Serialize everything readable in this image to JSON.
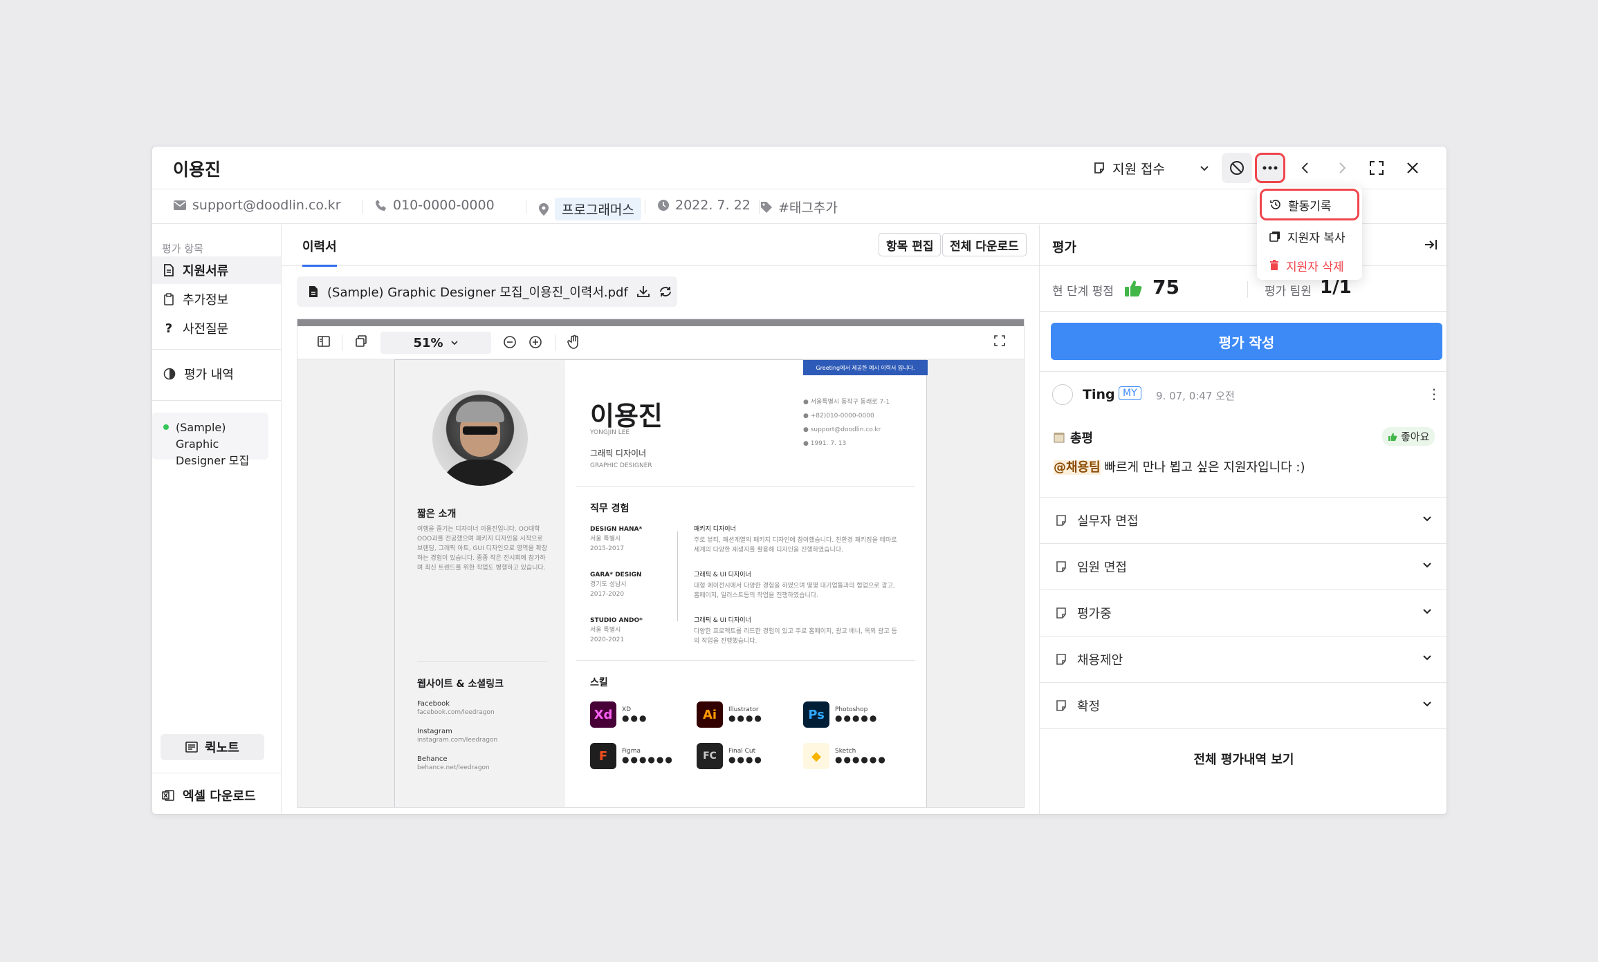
{
  "header": {
    "name": "이용진",
    "status": "지원 접수"
  },
  "info": {
    "email": "support@doodlin.co.kr",
    "phone": "010-0000-0000",
    "location": "프로그래머스",
    "date": "2022. 7. 22",
    "tag": "#태그추가"
  },
  "sidebar": {
    "caption": "평가 항목",
    "items": [
      "지원서류",
      "추가정보",
      "사전질문"
    ],
    "history": "평가 내역",
    "posting": "(Sample) Graphic Designer 모집",
    "quicknote": "퀵노트",
    "excel": "엑셀 다운로드"
  },
  "main": {
    "tab": "이력서",
    "edit_btn": "항목 편집",
    "download_btn": "전체 다운로드",
    "file": "(Sample) Graphic Designer 모집_이용진_이력서.pdf",
    "zoom": "51%"
  },
  "resume": {
    "banner": "Greeting에서 제공한 예시 이력서 입니다.",
    "name": "이용진",
    "name_en": "YONGJIN LEE",
    "role": "그래픽 디자이너",
    "role_en": "GRAPHIC DESIGNER",
    "contacts": [
      "서울특별시 동작구 동래로 7-1",
      "+82)010-0000-0000",
      "support@doodlin.co.kr",
      "1991. 7. 13"
    ],
    "intro_title": "짧은 소개",
    "intro": "여행을 즐기는 디자이너 이용진입니다. OO대학 OOO과를 전공했으며 패키지 디자인을 시작으로 브랜딩, 그래픽 아트, GUI 디자인으로 영역을 확장하는 경험이 있습니다. 종종 작은 전시회에 참가하며 최신 트렌드를 위한 작업도 병행하고 있습니다.",
    "links_title": "웹사이트 & 소셜링크",
    "links": [
      {
        "name": "Facebook",
        "url": "facebook.com/leedragon"
      },
      {
        "name": "Instagram",
        "url": "instagram.com/leedragon"
      },
      {
        "name": "Behance",
        "url": "behance.net/leedragon"
      }
    ],
    "exp_title": "직무 경험",
    "experience": [
      {
        "company": "DESIGN HANA*",
        "loc": "서울 특별시",
        "period": "2015-2017",
        "role": "패키지 디자이너",
        "desc": "주로 뷰티, 패션계열의 패키지 디자인에 참여했습니다. 친환경 패키징을 테마로 세계의 다양한 재생지를 활용해 디자인을 진행하였습니다."
      },
      {
        "company": "GARA* DESIGN",
        "loc": "경기도 성남시",
        "period": "2017-2020",
        "role": "그래픽 & UI 디자이너",
        "desc": "대형 에이전시에서 다양한 경험을 하였으며 몇몇 대기업들과의 협업으로 광고, 홈페이지, 일러스트등의 작업을 진행하였습니다."
      },
      {
        "company": "STUDIO ANDO*",
        "loc": "서울 특별시",
        "period": "2020-2021",
        "role": "그래픽 & UI 디자이너",
        "desc": "다양한 프로젝트를 리드한 경험이 있고 주로 홈페이지, 광고 배너, 옥외 광고 등의 작업을 진행했습니다."
      }
    ],
    "skills_title": "스킬",
    "skills": [
      {
        "name": "XD",
        "abbr": "Xd",
        "dots": "●●●",
        "bg": "#470137",
        "fg": "#ff61f6"
      },
      {
        "name": "Illustrator",
        "abbr": "Ai",
        "dots": "●●●●",
        "bg": "#330000",
        "fg": "#ff9a00"
      },
      {
        "name": "Photoshop",
        "abbr": "Ps",
        "dots": "●●●●●",
        "bg": "#001e36",
        "fg": "#31a8ff"
      },
      {
        "name": "Figma",
        "abbr": "F",
        "dots": "●●●●●●",
        "bg": "#1e1e1e",
        "fg": "#f24e1e"
      },
      {
        "name": "Final Cut",
        "abbr": "FC",
        "dots": "●●●●",
        "bg": "#222222",
        "fg": "#c9c9c9"
      },
      {
        "name": "Sketch",
        "abbr": "◆",
        "dots": "●●●●●●",
        "bg": "#fff7e0",
        "fg": "#f7b500"
      }
    ]
  },
  "evaluation": {
    "title": "평가",
    "stage_score_label": "현 단계 평점",
    "score": "75",
    "members_label": "평가 팀원",
    "members": "1/1",
    "write_btn": "평가 작성",
    "comment": {
      "author": "Ting",
      "badge": "MY",
      "time": "9. 07, 0:47 오전",
      "category": "총평",
      "reaction": "좋아요",
      "mention": "@채용팀",
      "text": " 빠르게 만나 뵙고 싶은 지원자입니다 :)"
    },
    "stages": [
      "실무자 면접",
      "임원 면접",
      "평가중",
      "채용제안",
      "확정"
    ],
    "all_history": "전체 평가내역 보기"
  },
  "menu": {
    "items": [
      "활동기록",
      "지원자 복사",
      "지원자 삭제"
    ],
    "danger_color": "#f0454c"
  },
  "colors": {
    "accent": "#3d8af7",
    "highlight": "#f0454c"
  }
}
